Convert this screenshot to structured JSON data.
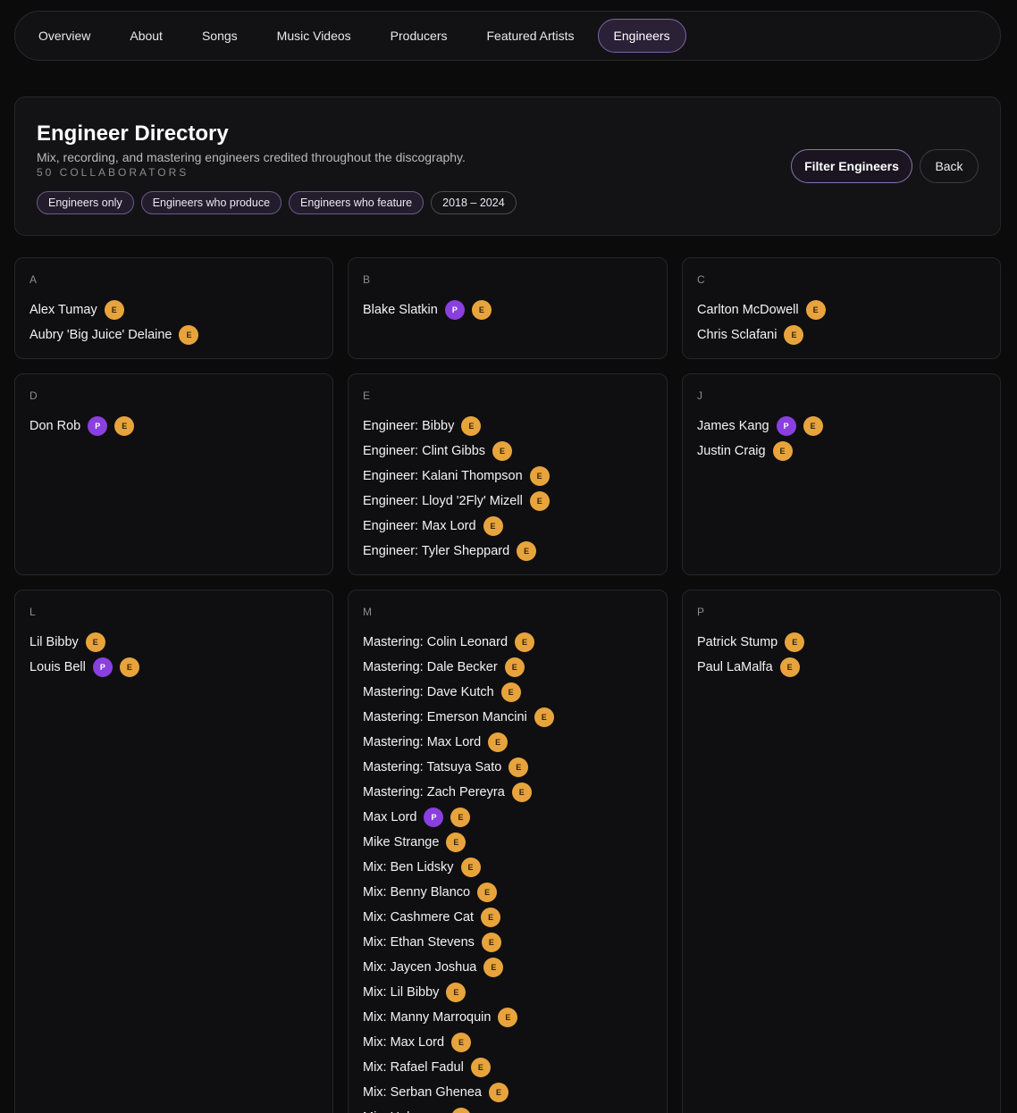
{
  "nav": {
    "items": [
      "Overview",
      "About",
      "Songs",
      "Music Videos",
      "Producers",
      "Featured Artists",
      "Engineers"
    ],
    "active": "Engineers"
  },
  "header": {
    "title": "Engineer Directory",
    "subtitle": "Mix, recording, and mastering engineers credited throughout the discography.",
    "count": "50 COLLABORATORS",
    "chips": [
      "Engineers only",
      "Engineers who produce",
      "Engineers who feature",
      "2018 – 2024"
    ],
    "filter_label": "Filter Engineers",
    "back_label": "Back"
  },
  "colors": {
    "producer_badge": "#8a3fe0",
    "engineer_badge": "#e8a43c",
    "accent": "#7d64a6"
  },
  "groups": [
    {
      "letter": "A",
      "people": [
        {
          "name": "Alex Tumay",
          "badges": [
            "E"
          ]
        },
        {
          "name": "Aubry 'Big Juice' Delaine",
          "badges": [
            "E"
          ]
        }
      ]
    },
    {
      "letter": "B",
      "people": [
        {
          "name": "Blake Slatkin",
          "badges": [
            "P",
            "E"
          ]
        }
      ]
    },
    {
      "letter": "C",
      "people": [
        {
          "name": "Carlton McDowell",
          "badges": [
            "E"
          ]
        },
        {
          "name": "Chris Sclafani",
          "badges": [
            "E"
          ]
        }
      ]
    },
    {
      "letter": "D",
      "people": [
        {
          "name": "Don Rob",
          "badges": [
            "P",
            "E"
          ]
        }
      ]
    },
    {
      "letter": "E",
      "people": [
        {
          "name": "Engineer: Bibby",
          "badges": [
            "E"
          ]
        },
        {
          "name": "Engineer: Clint Gibbs",
          "badges": [
            "E"
          ]
        },
        {
          "name": "Engineer: Kalani Thompson",
          "badges": [
            "E"
          ]
        },
        {
          "name": "Engineer: Lloyd '2Fly' Mizell",
          "badges": [
            "E"
          ]
        },
        {
          "name": "Engineer: Max Lord",
          "badges": [
            "E"
          ]
        },
        {
          "name": "Engineer: Tyler Sheppard",
          "badges": [
            "E"
          ]
        }
      ]
    },
    {
      "letter": "J",
      "people": [
        {
          "name": "James Kang",
          "badges": [
            "P",
            "E"
          ]
        },
        {
          "name": "Justin Craig",
          "badges": [
            "E"
          ]
        }
      ]
    },
    {
      "letter": "L",
      "people": [
        {
          "name": "Lil Bibby",
          "badges": [
            "E"
          ]
        },
        {
          "name": "Louis Bell",
          "badges": [
            "P",
            "E"
          ]
        }
      ]
    },
    {
      "letter": "M",
      "people": [
        {
          "name": "Mastering: Colin Leonard",
          "badges": [
            "E"
          ]
        },
        {
          "name": "Mastering: Dale Becker",
          "badges": [
            "E"
          ]
        },
        {
          "name": "Mastering: Dave Kutch",
          "badges": [
            "E"
          ]
        },
        {
          "name": "Mastering: Emerson Mancini",
          "badges": [
            "E"
          ]
        },
        {
          "name": "Mastering: Max Lord",
          "badges": [
            "E"
          ]
        },
        {
          "name": "Mastering: Tatsuya Sato",
          "badges": [
            "E"
          ]
        },
        {
          "name": "Mastering: Zach Pereyra",
          "badges": [
            "E"
          ]
        },
        {
          "name": "Max Lord",
          "badges": [
            "P",
            "E"
          ]
        },
        {
          "name": "Mike Strange",
          "badges": [
            "E"
          ]
        },
        {
          "name": "Mix: Ben Lidsky",
          "badges": [
            "E"
          ]
        },
        {
          "name": "Mix: Benny Blanco",
          "badges": [
            "E"
          ]
        },
        {
          "name": "Mix: Cashmere Cat",
          "badges": [
            "E"
          ]
        },
        {
          "name": "Mix: Ethan Stevens",
          "badges": [
            "E"
          ]
        },
        {
          "name": "Mix: Jaycen Joshua",
          "badges": [
            "E"
          ]
        },
        {
          "name": "Mix: Lil Bibby",
          "badges": [
            "E"
          ]
        },
        {
          "name": "Mix: Manny Marroquin",
          "badges": [
            "E"
          ]
        },
        {
          "name": "Mix: Max Lord",
          "badges": [
            "E"
          ]
        },
        {
          "name": "Mix: Rafael Fadul",
          "badges": [
            "E"
          ]
        },
        {
          "name": "Mix: Serban Ghenea",
          "badges": [
            "E"
          ]
        },
        {
          "name": "Mix: Unknown",
          "badges": [
            "E"
          ]
        }
      ]
    },
    {
      "letter": "P",
      "people": [
        {
          "name": "Patrick Stump",
          "badges": [
            "E"
          ]
        },
        {
          "name": "Paul LaMalfa",
          "badges": [
            "E"
          ]
        }
      ]
    }
  ]
}
